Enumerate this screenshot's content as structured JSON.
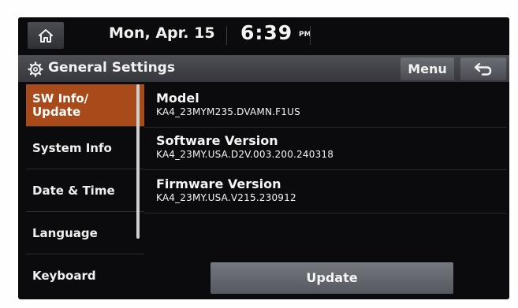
{
  "status": {
    "date": "Mon, Apr. 15",
    "time": "6:39",
    "ampm": "PM"
  },
  "header": {
    "title": "General Settings",
    "menu_label": "Menu"
  },
  "sidebar": {
    "items": [
      {
        "label": "SW Info/\nUpdate",
        "active": true
      },
      {
        "label": "System Info",
        "active": false
      },
      {
        "label": "Date & Time",
        "active": false
      },
      {
        "label": "Language",
        "active": false
      },
      {
        "label": "Keyboard",
        "active": false
      }
    ]
  },
  "details": [
    {
      "label": "Model",
      "value": "KA4_23MYM235.DVAMN.F1US"
    },
    {
      "label": "Software Version",
      "value": "KA4_23MY.USA.D2V.003.200.240318"
    },
    {
      "label": "Firmware Version",
      "value": "KA4_23MY.USA.V215.230912"
    }
  ],
  "update_label": "Update",
  "colors": {
    "accent": "#a84a1a",
    "background": "#0b0b0d"
  },
  "icons": [
    "home-icon",
    "gear-icon",
    "back-arrow-icon"
  ]
}
